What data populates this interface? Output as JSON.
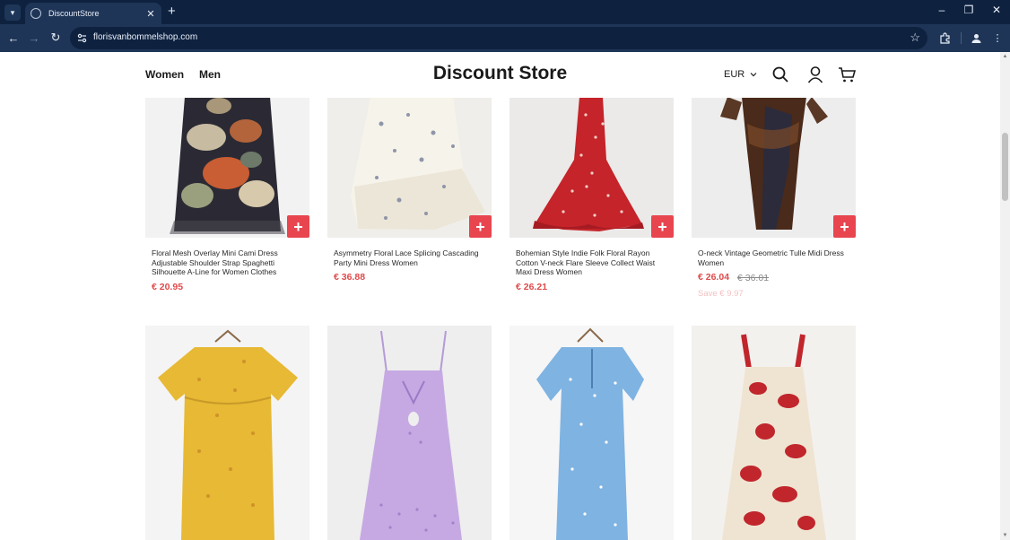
{
  "browser": {
    "tab_title": "DiscountStore",
    "url": "florisvanbommelshop.com"
  },
  "header": {
    "nav": [
      "Women",
      "Men"
    ],
    "brand": "Discount Store",
    "currency": "EUR"
  },
  "products": [
    {
      "name": "Floral Mesh Overlay Mini Cami Dress Adjustable Shoulder Strap Spaghetti Silhouette A-Line for Women Clothes",
      "price": "€ 20.95",
      "image": "floral-mini-dress"
    },
    {
      "name": "Asymmetry Floral Lace Splicing Cascading Party Mini Dress Women",
      "price": "€ 36.88",
      "image": "asymmetric-cream-dress"
    },
    {
      "name": "Bohemian Style Indie Folk Floral Rayon Cotton V-neck Flare Sleeve Collect Waist Maxi Dress Women",
      "price": "€ 26.21",
      "image": "red-floral-maxi-dress"
    },
    {
      "name": "O-neck Vintage Geometric Tulle Midi Dress Women",
      "price": "€ 26.04",
      "old_price": "€ 36.01",
      "save": "Save € 9.97",
      "image": "tulle-midi-dress"
    },
    {
      "image": "yellow-floral-dress"
    },
    {
      "image": "lilac-eyelet-dress"
    },
    {
      "image": "blue-floral-dress"
    },
    {
      "image": "red-floral-strap-dress"
    }
  ],
  "colors": {
    "accent": "#e8454f",
    "price": "#e04a4a",
    "chrome_dark": "#0e2240",
    "chrome": "#1f3557"
  }
}
